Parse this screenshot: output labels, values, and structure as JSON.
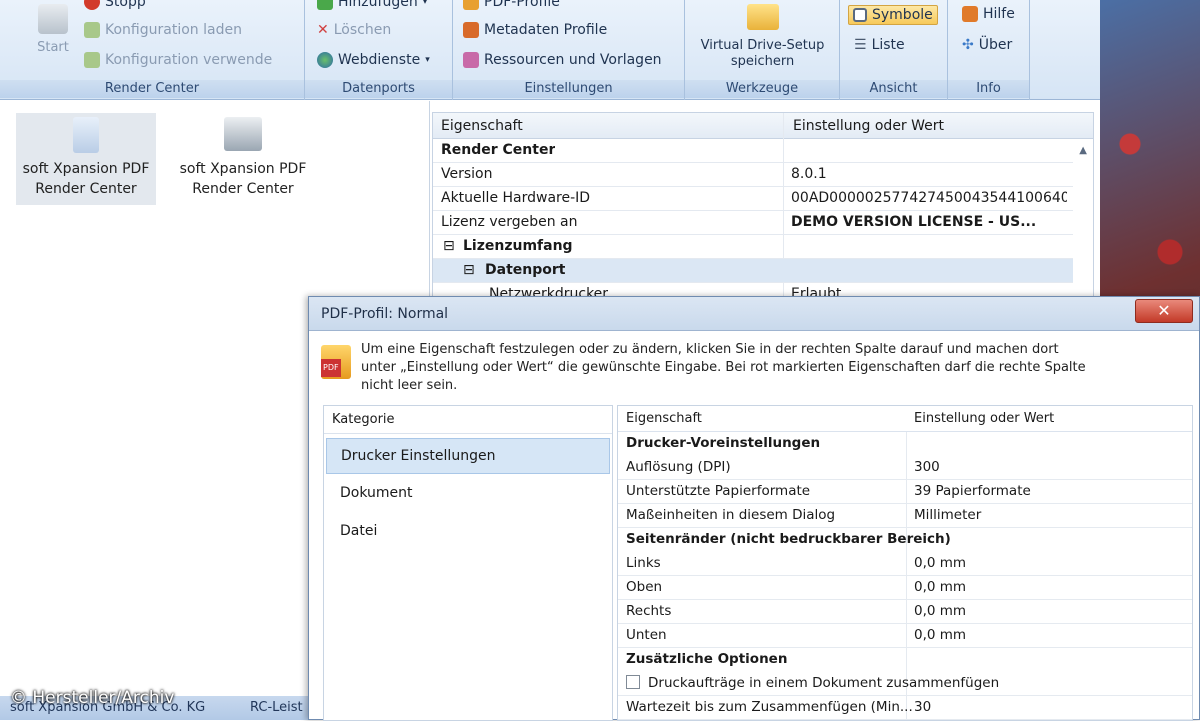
{
  "ribbon": {
    "render_center": {
      "label": "Render Center",
      "start_label": "Start",
      "stopp_label": "Stopp",
      "laden_label": "Konfiguration laden",
      "verwenden_label": "Konfiguration verwende"
    },
    "datenports": {
      "label": "Datenports",
      "hinzufuegen_label": "Hinzufügen",
      "loeschen_label": "Löschen",
      "webdienste_label": "Webdienste"
    },
    "einstellungen": {
      "label": "Einstellungen",
      "pdf_profile_label": "PDF-Profile",
      "metadaten_label": "Metadaten Profile",
      "ressourcen_label": "Ressourcen und Vorlagen"
    },
    "werkzeuge": {
      "label": "Werkzeuge",
      "virtual_drive_line1": "Virtual Drive-Setup",
      "virtual_drive_line2": "speichern"
    },
    "ansicht": {
      "label": "Ansicht",
      "symbole_label": "Symbole",
      "liste_label": "Liste"
    },
    "info": {
      "label": "Info",
      "hilfe_label": "Hilfe",
      "ueber_label": "Über"
    }
  },
  "tiles": [
    {
      "line1": "soft Xpansion PDF",
      "line2": "Render Center"
    },
    {
      "line1": "soft Xpansion PDF",
      "line2": "Render Center"
    }
  ],
  "properties": {
    "col_property": "Eigenschaft",
    "col_value": "Einstellung oder Wert",
    "rows": [
      {
        "name": "Render Center",
        "value": ""
      },
      {
        "name": "Version",
        "value": "8.0.1"
      },
      {
        "name": "Aktuelle Hardware-ID",
        "value": "00AD000002577427450043544100640..."
      },
      {
        "name": "Lizenz vergeben an",
        "value": "DEMO VERSION LICENSE - US..."
      },
      {
        "name": "Lizenzumfang",
        "value": ""
      },
      {
        "name": "Datenport",
        "value": ""
      },
      {
        "name": "Netzwerkdrucker",
        "value": "Erlaubt"
      }
    ]
  },
  "dialog": {
    "title": "PDF-Profil: Normal",
    "close_glyph": "✕",
    "info_line1": "Um eine Eigenschaft festzulegen oder zu ändern, klicken Sie in der rechten Spalte darauf und machen dort",
    "info_line2": "unter „Einstellung oder Wert“ die gewünschte Eingabe. Bei rot markierten Eigenschaften darf die rechte Spalte",
    "info_line3": "nicht leer sein.",
    "category_header": "Kategorie",
    "categories": [
      "Drucker Einstellungen",
      "Dokument",
      "Datei"
    ],
    "grid": {
      "col_property": "Eigenschaft",
      "col_value": "Einstellung oder Wert",
      "rows": [
        {
          "name": "Drucker-Voreinstellungen",
          "value": ""
        },
        {
          "name": "Auflösung (DPI)",
          "value": "300"
        },
        {
          "name": "Unterstützte Papierformate",
          "value": "39 Papierformate"
        },
        {
          "name": "Maßeinheiten in diesem Dialog",
          "value": "Millimeter"
        },
        {
          "name": "Seitenränder (nicht bedruckbarer Bereich)",
          "value": ""
        },
        {
          "name": "Links",
          "value": "0,0 mm"
        },
        {
          "name": "Oben",
          "value": "0,0 mm"
        },
        {
          "name": "Rechts",
          "value": "0,0 mm"
        },
        {
          "name": "Unten",
          "value": "0,0 mm"
        },
        {
          "name": "Zusätzliche Optionen",
          "value": ""
        },
        {
          "name": "Druckaufträge in einem Dokument zusammenfügen",
          "value": ""
        },
        {
          "name": "Wartezeit bis zum Zusammenfügen (Min...",
          "value": "30"
        }
      ]
    }
  },
  "status": {
    "left_text": "soft Xpansion GmbH & Co. KG",
    "right_text": "RC-Leist"
  },
  "watermark": "© Hersteller/Archiv",
  "colors": {
    "ribbon_bg": "#d6e5f5",
    "accent_selected": "#f7c95a",
    "close_red": "#c33a28"
  }
}
